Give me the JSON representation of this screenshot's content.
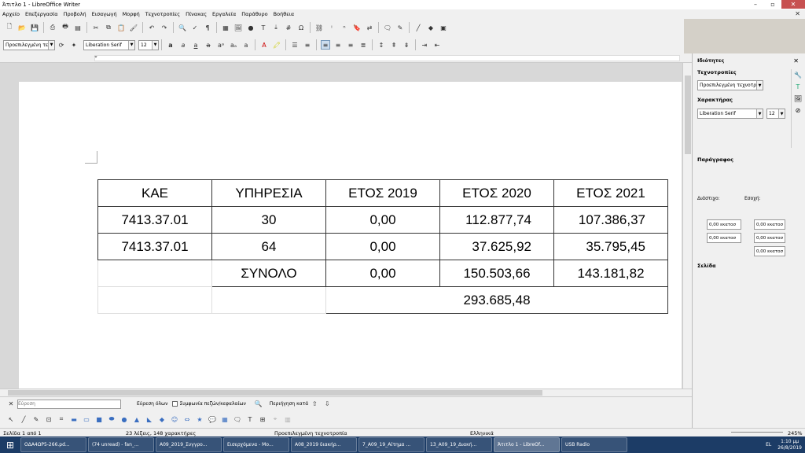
{
  "window": {
    "title": "Άτιτλο 1 - LibreOffice Writer"
  },
  "menu": [
    "Αρχείο",
    "Επεξεργασία",
    "Προβολή",
    "Εισαγωγή",
    "Μορφή",
    "Τεχνοτροπίες",
    "Πίνακας",
    "Εργαλεία",
    "Παράθυρο",
    "Βοήθεια"
  ],
  "format_bar": {
    "paragraph_style": "Προεπιλεγμένη τεχ",
    "font_name": "Liberation Serif",
    "font_size": "12"
  },
  "table": {
    "headers": [
      "ΚΑΕ",
      "ΥΠΗΡΕΣΙΑ",
      "ΕΤΟΣ 2019",
      "ΕΤΟΣ 2020",
      "ΕΤΟΣ 2021"
    ],
    "rows": [
      [
        "7413.37.01",
        "30",
        "0,00",
        "112.877,74",
        "107.386,37"
      ],
      [
        "7413.37.01",
        "64",
        "0,00",
        "37.625,92",
        "35.795,45"
      ]
    ],
    "total_label": "ΣΥΝΟΛΟ",
    "totals": [
      "0,00",
      "150.503,66",
      "143.181,82"
    ],
    "grand_total": "293.685,48"
  },
  "sidebar": {
    "title": "Ιδιότητες",
    "styles_section": "Τεχνοτροπίες",
    "style_value": "Προεπιλεγμένη τεχνοτρο",
    "char_section": "Χαρακτήρας",
    "font_name": "Liberation Serif",
    "font_size": "12",
    "para_section": "Παράγραφος",
    "spacing_label": "Διάστιχο:",
    "indent_label": "Εσοχή:",
    "val1": "0,00 εκατοσ",
    "val2": "0,00 εκατοσ",
    "val3": "0,00 εκατοσ",
    "val4": "0,00 εκατοσ",
    "val5": "0,00 εκατοσ",
    "page_section": "Σελίδα"
  },
  "find": {
    "placeholder": "Εύρεση",
    "find_all": "Εύρεση όλων",
    "match_case": "Συμφωνία πεζών/κεφαλαίων",
    "search_mode": "Περιήγηση κατά"
  },
  "status": {
    "page": "Σελίδα 1 από 1",
    "words": "23 λέξεις, 148 χαρακτήρες",
    "style": "Προεπιλεγμένη τεχνοτροπία",
    "language": "Ελληνικά",
    "zoom": "245%"
  },
  "taskbar": {
    "items": [
      "ΟΔΑ4ΩΡ5-266.pd...",
      "(74 unread) - fan_...",
      "Α09_2019_Συγγρο...",
      "Εισερχόμενα - Μο...",
      "Α08_2019 διακήρ...",
      "7_Α09_19_Αίτημα ...",
      "13_Α09_19_Διακή...",
      "Άτιτλο 1 - LibreOf...",
      "USB Radio"
    ],
    "lang": "EL",
    "time": "1:10 μμ",
    "date": "26/8/2019"
  }
}
